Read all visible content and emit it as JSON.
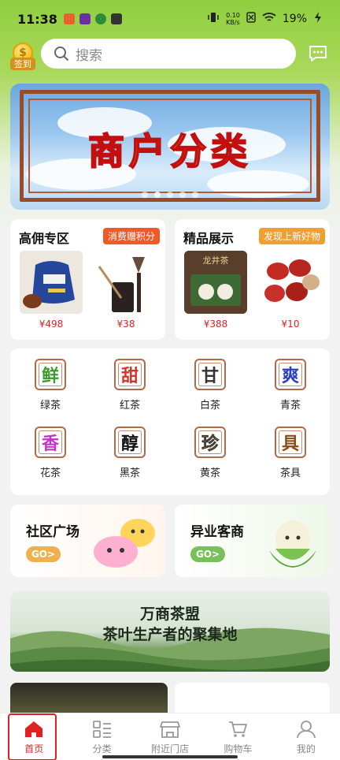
{
  "status": {
    "time": "11:38",
    "net_speed": "0.10",
    "net_unit": "KB/s",
    "battery": "19%"
  },
  "header": {
    "signin_label": "签到",
    "signin_coin": "$",
    "search_placeholder": "搜索"
  },
  "banner": {
    "title": "商户分类",
    "dots": 5,
    "active_dot": 2
  },
  "commission": {
    "title": "高佣专区",
    "badge": "消费赠积分",
    "badge_color": "#f05a28",
    "products": [
      {
        "price": "¥498",
        "image": "tea-pack-image"
      },
      {
        "price": "¥38",
        "image": "tea-tools-image"
      }
    ]
  },
  "showcase": {
    "title": "精品展示",
    "badge": "发现上新好物",
    "badge_color": "#f0a030",
    "products": [
      {
        "price": "¥388",
        "image": "tea-giftbox-image",
        "label": "龙井茶"
      },
      {
        "price": "¥10",
        "image": "red-dates-image"
      }
    ]
  },
  "categories": [
    {
      "char": "鲜",
      "name": "绿茶",
      "color": "#3c9a2a"
    },
    {
      "char": "甜",
      "name": "红茶",
      "color": "#d6332a"
    },
    {
      "char": "甘",
      "name": "白茶",
      "color": "#333333"
    },
    {
      "char": "爽",
      "name": "青茶",
      "color": "#2a3fc4"
    },
    {
      "char": "香",
      "name": "花茶",
      "color": "#c233c9"
    },
    {
      "char": "醇",
      "name": "黑茶",
      "color": "#111111"
    },
    {
      "char": "珍",
      "name": "黄茶",
      "color": "#e0b800"
    },
    {
      "char": "具",
      "name": "茶具",
      "color": "#8a4a1a"
    }
  ],
  "tiles": [
    {
      "title": "社区广场",
      "go": "GO>",
      "go_color": "#f0b050"
    },
    {
      "title": "异业客商",
      "go": "GO>",
      "go_color": "#78c05a"
    }
  ],
  "tea_banner": {
    "line1": "万商茶盟",
    "line2": "茶叶生产者的聚集地"
  },
  "tabs": [
    {
      "label": "首页",
      "icon": "home-icon"
    },
    {
      "label": "分类",
      "icon": "category-icon"
    },
    {
      "label": "附近门店",
      "icon": "store-icon"
    },
    {
      "label": "购物车",
      "icon": "cart-icon"
    },
    {
      "label": "我的",
      "icon": "user-icon"
    }
  ]
}
